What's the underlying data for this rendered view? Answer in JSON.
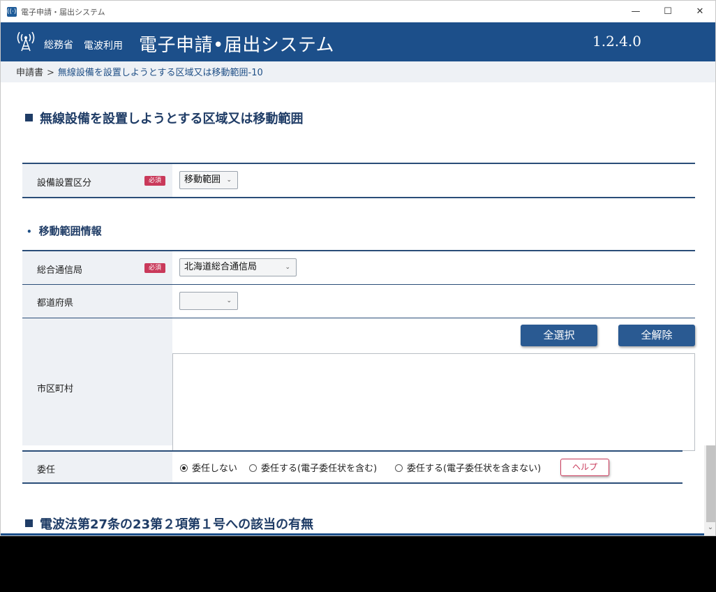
{
  "window": {
    "title": "電子申請・届出システム",
    "controls": {
      "minimize": "—",
      "maximize": "☐",
      "close": "✕"
    }
  },
  "header": {
    "ministry": "総務省",
    "radio_use": "電波利用",
    "system_name": "電子申請•届出システム",
    "version": "1.2.4.0"
  },
  "breadcrumb": {
    "root": "申請書",
    "separator": ">",
    "current": "無線設備を設置しようとする区域又は移動範囲-10"
  },
  "section1": {
    "title": "無線設備を設置しようとする区域又は移動範囲",
    "install_category": {
      "label": "設備設置区分",
      "required": "必須",
      "value": "移動範囲"
    }
  },
  "movement_info": {
    "title": "移動範囲情報",
    "bureau": {
      "label": "総合通信局",
      "required": "必須",
      "value": "北海道総合通信局"
    },
    "prefecture": {
      "label": "都道府県",
      "value": ""
    },
    "municipality": {
      "label": "市区町村",
      "select_all": "全選択",
      "clear_all": "全解除"
    }
  },
  "delegation": {
    "label": "委任",
    "options": [
      "委任しない",
      "委任する(電子委任状を含む)",
      "委任する(電子委任状を含まない)"
    ],
    "selected_index": 0,
    "help": "ヘルプ"
  },
  "section2": {
    "title": "電波法第27条の23第２項第１号への該当の有無"
  },
  "colors": {
    "header_bg": "#1c4f8a",
    "accent": "#1f3c66",
    "required_badge": "#c9395a",
    "button_bg": "#2a5a92"
  },
  "icons": {
    "app": "antenna-icon",
    "chevron": "chevron-down-icon"
  }
}
